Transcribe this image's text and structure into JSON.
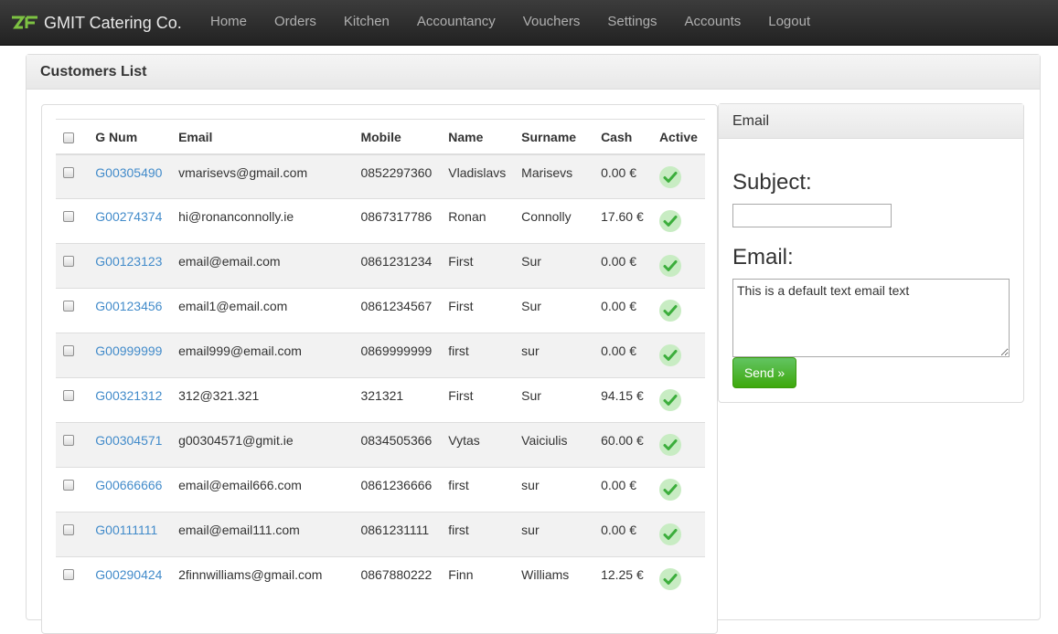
{
  "brand": {
    "name": "GMIT Catering Co.",
    "logo_text": "ZF"
  },
  "nav": {
    "items": [
      {
        "label": "Home"
      },
      {
        "label": "Orders"
      },
      {
        "label": "Kitchen"
      },
      {
        "label": "Accountancy"
      },
      {
        "label": "Vouchers"
      },
      {
        "label": "Settings"
      },
      {
        "label": "Accounts"
      },
      {
        "label": "Logout"
      }
    ]
  },
  "panel": {
    "title": "Customers List"
  },
  "table": {
    "headers": {
      "gnum": "G Num",
      "email": "Email",
      "mobile": "Mobile",
      "name": "Name",
      "surname": "Surname",
      "cash": "Cash",
      "active": "Active"
    },
    "rows": [
      {
        "gnum": "G00305490",
        "email": "vmarisevs@gmail.com",
        "mobile": "0852297360",
        "name": "Vladislavs",
        "surname": "Marisevs",
        "cash": "0.00 €",
        "active": "check-icon"
      },
      {
        "gnum": "G00274374",
        "email": "hi@ronanconnolly.ie",
        "mobile": "0867317786",
        "name": "Ronan",
        "surname": "Connolly",
        "cash": "17.60 €",
        "active": "check-icon"
      },
      {
        "gnum": "G00123123",
        "email": "email@email.com",
        "mobile": "0861231234",
        "name": "First",
        "surname": "Sur",
        "cash": "0.00 €",
        "active": "check-icon"
      },
      {
        "gnum": "G00123456",
        "email": "email1@email.com",
        "mobile": "0861234567",
        "name": "First",
        "surname": "Sur",
        "cash": "0.00 €",
        "active": "check-icon"
      },
      {
        "gnum": "G00999999",
        "email": "email999@email.com",
        "mobile": "0869999999",
        "name": "first",
        "surname": "sur",
        "cash": "0.00 €",
        "active": "check-icon"
      },
      {
        "gnum": "G00321312",
        "email": "312@321.321",
        "mobile": "321321",
        "name": "First",
        "surname": "Sur",
        "cash": "94.15 €",
        "active": "check-icon"
      },
      {
        "gnum": "G00304571",
        "email": "g00304571@gmit.ie",
        "mobile": "0834505366",
        "name": "Vytas",
        "surname": "Vaiciulis",
        "cash": "60.00 €",
        "active": "check-icon"
      },
      {
        "gnum": "G00666666",
        "email": "email@email666.com",
        "mobile": "0861236666",
        "name": "first",
        "surname": "sur",
        "cash": "0.00 €",
        "active": "check-icon"
      },
      {
        "gnum": "G00111111",
        "email": "email@email111.com",
        "mobile": "0861231111",
        "name": "first",
        "surname": "sur",
        "cash": "0.00 €",
        "active": "check-icon"
      },
      {
        "gnum": "G00290424",
        "email": "2finnwilliams@gmail.com",
        "mobile": "0867880222",
        "name": "Finn",
        "surname": "Williams",
        "cash": "12.25 €",
        "active": "check-icon"
      }
    ]
  },
  "email_panel": {
    "title": "Email",
    "subject_label": "Subject:",
    "subject_value": "",
    "email_label": "Email:",
    "email_value": "This is a default text email text",
    "send_label": "Send »"
  },
  "colors": {
    "link": "#428bca",
    "send_button": "#4cae1c",
    "active_check": "#5cb85c",
    "navbar": "#2a2a2a"
  }
}
